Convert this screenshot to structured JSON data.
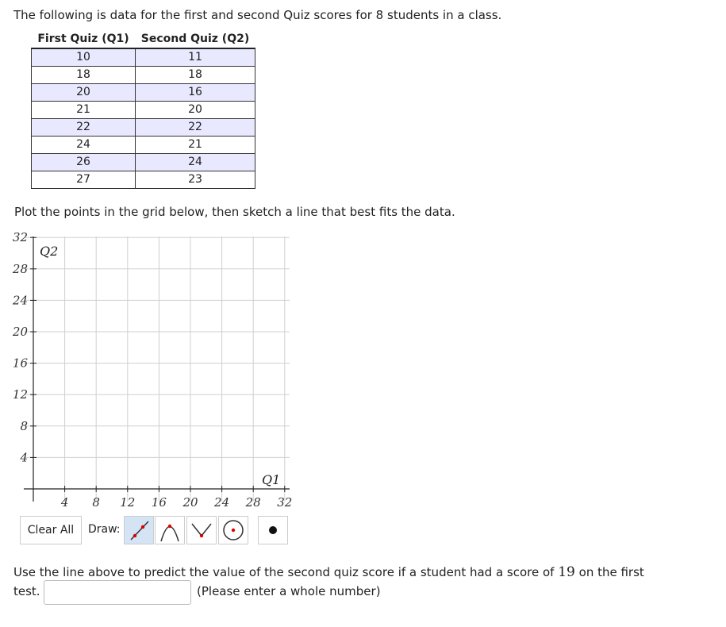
{
  "intro": "The following is data for the first and second Quiz scores for 8 students in a class.",
  "table": {
    "headers": [
      "First Quiz (Q1)",
      "Second Quiz (Q2)"
    ],
    "rows": [
      [
        "10",
        "11"
      ],
      [
        "18",
        "18"
      ],
      [
        "20",
        "16"
      ],
      [
        "21",
        "20"
      ],
      [
        "22",
        "22"
      ],
      [
        "24",
        "21"
      ],
      [
        "26",
        "24"
      ],
      [
        "27",
        "23"
      ]
    ]
  },
  "instruction": "Plot the points in the grid below, then sketch a line that best fits the data.",
  "graph": {
    "x_label": "Q1",
    "y_label": "Q2",
    "x_ticks": [
      "4",
      "8",
      "12",
      "16",
      "20",
      "24",
      "28",
      "32"
    ],
    "y_ticks": [
      "4",
      "8",
      "12",
      "16",
      "20",
      "24",
      "28",
      "32"
    ],
    "x_range": [
      0,
      32
    ],
    "y_range": [
      0,
      32
    ]
  },
  "toolbar": {
    "clear_label": "Clear All",
    "draw_label": "Draw:",
    "tools": [
      "line-tool-icon",
      "parabola-tool-icon",
      "vertex-tool-icon",
      "circle-tool-icon",
      "point-tool-icon"
    ]
  },
  "question": {
    "before": "Use the line above to predict the value of the second quiz score if a student had a score of ",
    "value": "19",
    "after": " on the first",
    "line2": "test.",
    "answer_value": "",
    "hint": "(Please enter a whole number)"
  },
  "colors": {
    "grid": "#d0d0d0",
    "axis": "#222222",
    "tool_selected": "#d5e4f5",
    "point_red": "#e00000"
  }
}
